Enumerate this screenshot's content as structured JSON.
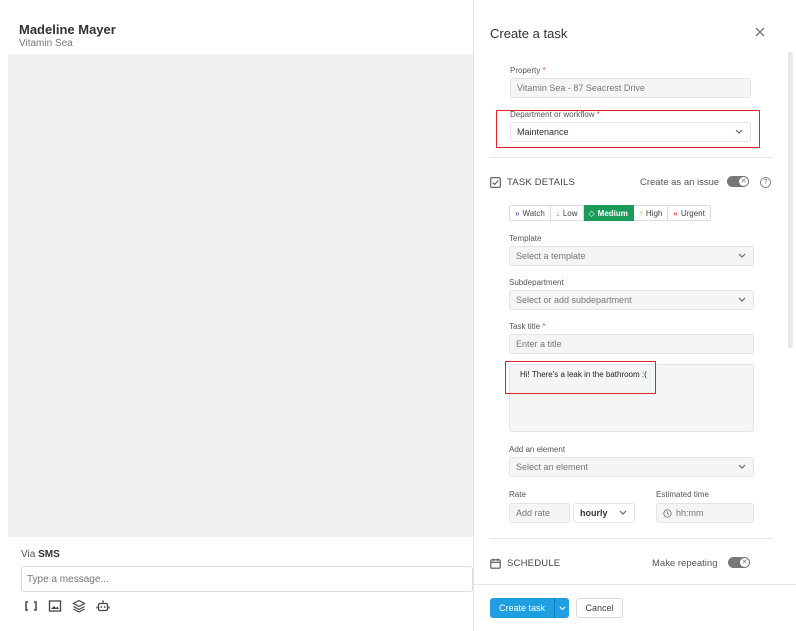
{
  "conversation": {
    "contact_name": "Madeline Mayer",
    "contact_sub": "Vitamin Sea",
    "via_prefix": "Via",
    "via_channel": "SMS",
    "message_placeholder": "Type a message...",
    "tool_icons": [
      "bracket-icon",
      "image-icon",
      "layers-icon",
      "bot-icon"
    ]
  },
  "modal": {
    "title": "Create a task",
    "property": {
      "label": "Property",
      "required": "*",
      "value": "Vitamin Sea - 87 Seacrest Drive"
    },
    "department": {
      "label": "Department or workflow",
      "required": "*",
      "value": "Maintenance"
    },
    "task_details": {
      "heading": "TASK DETAILS",
      "issue_toggle_label": "Create as an issue",
      "toggle_knob": "✕",
      "help": "?"
    },
    "priorities": [
      {
        "icon": "»",
        "label": "Watch",
        "color": "#7b5cc9"
      },
      {
        "icon": "↓",
        "label": "Low",
        "color": "#2f7fd8"
      },
      {
        "icon": "◇",
        "label": "Medium",
        "color": "#ffffff"
      },
      {
        "icon": "↑",
        "label": "High",
        "color": "#f0962c"
      },
      {
        "icon": "«",
        "label": "Urgent",
        "color": "#e04848"
      }
    ],
    "template": {
      "label": "Template",
      "placeholder": "Select a template"
    },
    "subdepartment": {
      "label": "Subdepartment",
      "placeholder": "Select or add subdepartment"
    },
    "task_title": {
      "label": "Task title",
      "required": "*",
      "placeholder": "Enter a title"
    },
    "description_value": "Hi! There's a leak in the bathroom :(",
    "element": {
      "label": "Add an element",
      "placeholder": "Select an element"
    },
    "rate": {
      "label": "Rate",
      "placeholder": "Add rate",
      "unit": "hourly"
    },
    "estimated_time": {
      "label": "Estimated time",
      "placeholder": "hh:mm"
    },
    "schedule": {
      "heading": "SCHEDULE",
      "repeat_label": "Make repeating",
      "toggle_knob": "✕"
    },
    "footer": {
      "create_label": "Create task",
      "cancel_label": "Cancel"
    }
  },
  "colors": {
    "accent": "#1d9fe0",
    "medium_active": "#1a9b5b",
    "highlight_box": "#e02424"
  }
}
